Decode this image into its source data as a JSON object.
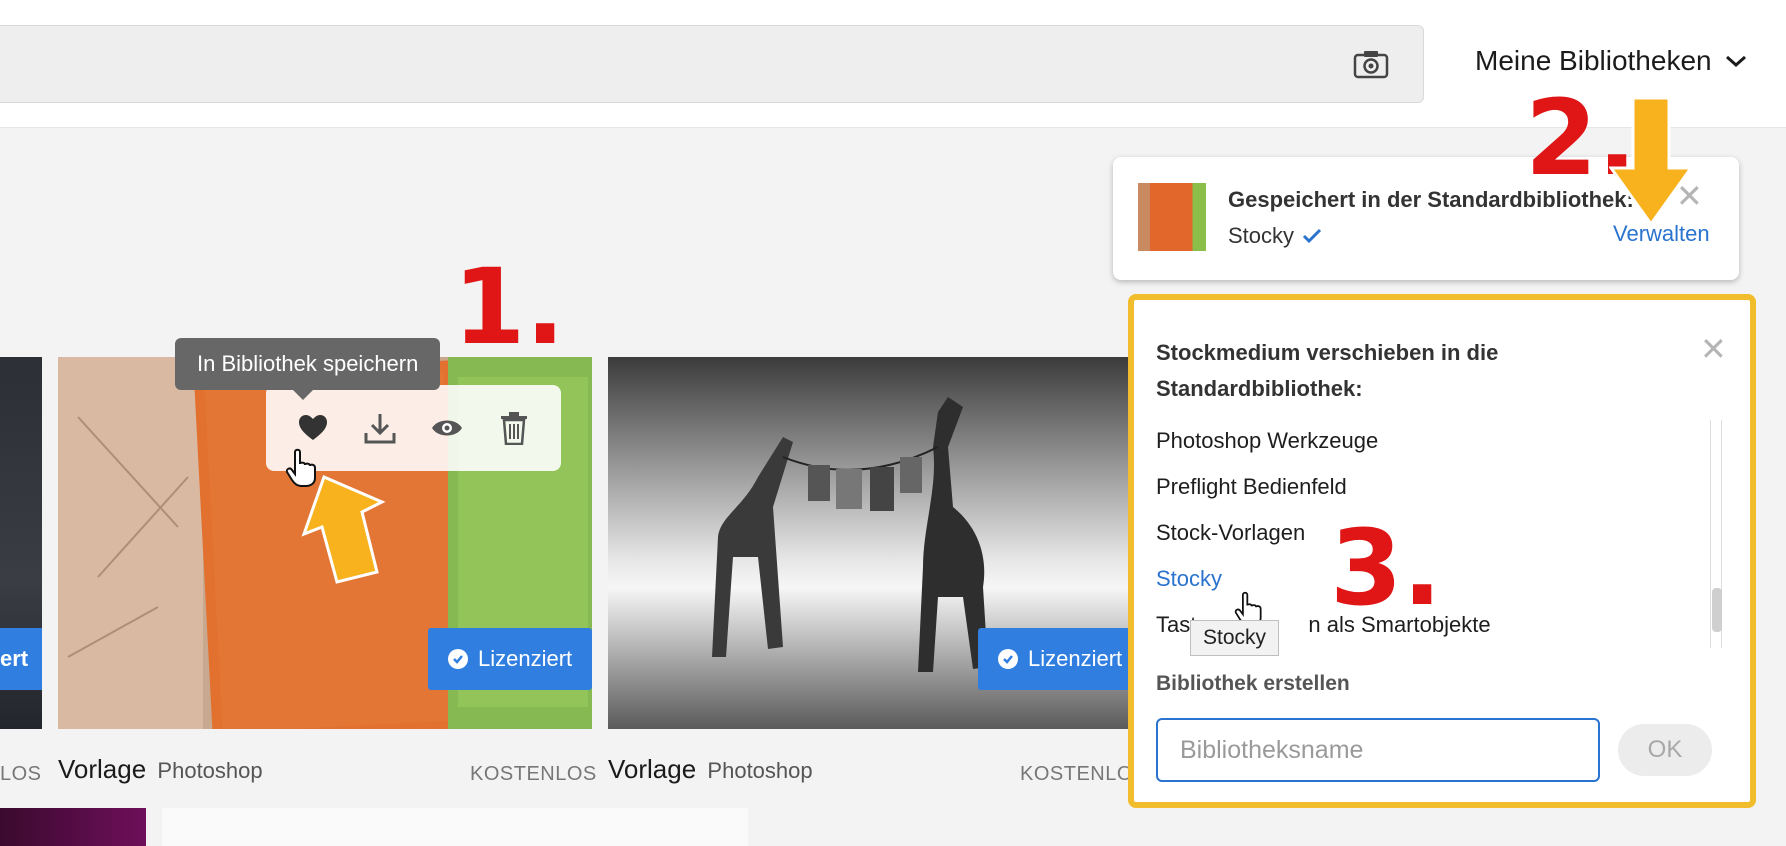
{
  "header": {
    "libraries_label": "Meine Bibliotheken"
  },
  "cards": [
    {
      "badge": "ert",
      "type": "",
      "app": "",
      "price": "LOS"
    },
    {
      "badge": "Lizenziert",
      "type": "Vorlage",
      "app": "Photoshop",
      "price": "KOSTENLOS"
    },
    {
      "badge": "Lizenziert",
      "type": "Vorlage",
      "app": "Photoshop",
      "price": "KOSTENLO"
    }
  ],
  "hover_tooltip": "In Bibliothek speichern",
  "annotations": {
    "step1": "1.",
    "step2": "2.",
    "step3": "3."
  },
  "toast": {
    "title": "Gespeichert in der Standardbibliothek:",
    "library": "Stocky",
    "manage": "Verwalten"
  },
  "move_panel": {
    "heading": "Stockmedium verschieben in die Standardbibliothek:",
    "items": [
      "Photoshop Werkzeuge",
      "Preflight Bedienfeld",
      "Stock-Vorlagen",
      "Stocky",
      "Tast",
      "n als Smartobjekte"
    ],
    "selected_index": 3,
    "hover_tooltip": "Stocky",
    "create_label": "Bibliothek erstellen",
    "name_placeholder": "Bibliotheksname",
    "ok_label": "OK"
  },
  "colors": {
    "accent": "#2a73cf",
    "badge": "#2f7ee0",
    "highlight_frame": "#f2bd2c",
    "annotation": "#e01616",
    "arrow": "#f7b21e"
  }
}
